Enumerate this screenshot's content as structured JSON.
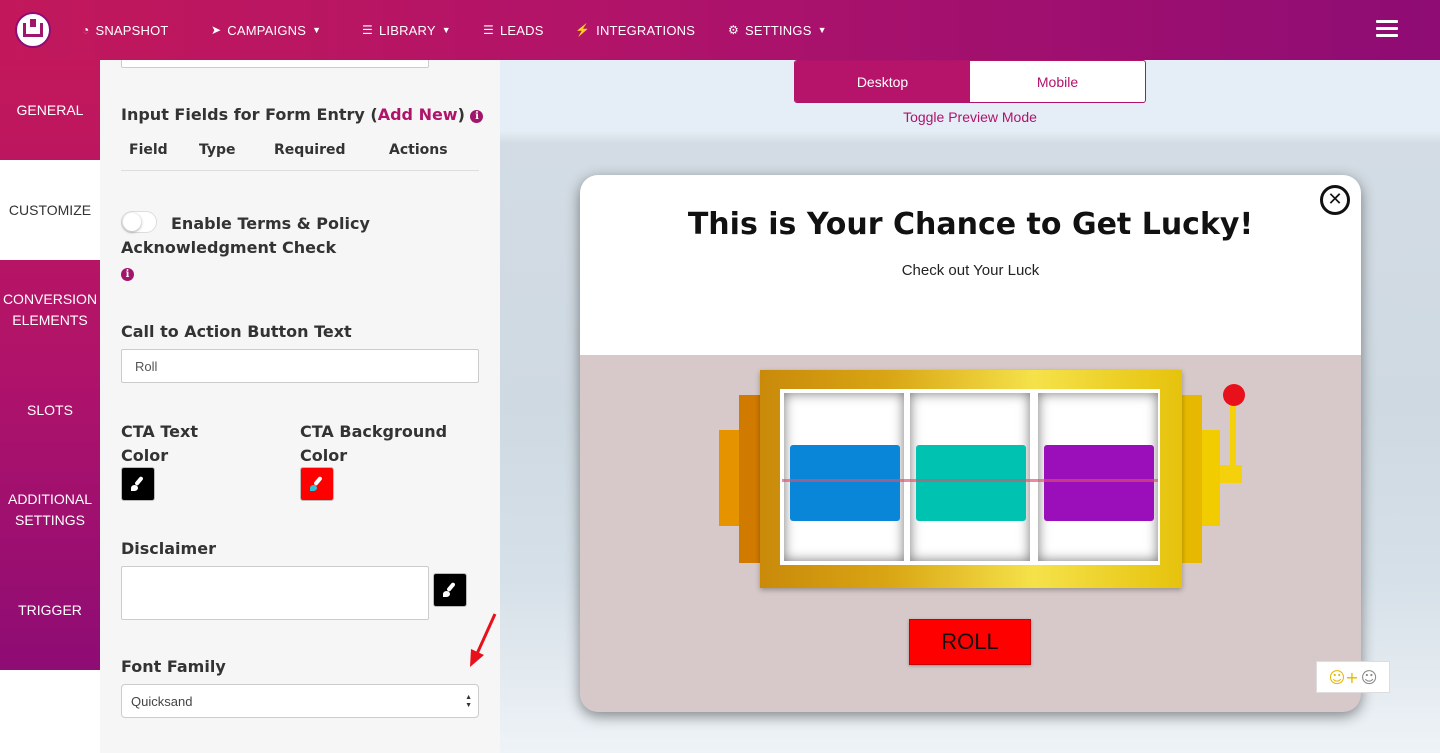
{
  "nav": {
    "items": [
      {
        "label": "SNAPSHOT",
        "icon": "dashboard-icon"
      },
      {
        "label": "CAMPAIGNS",
        "icon": "paper-plane-icon",
        "dropdown": true
      },
      {
        "label": "LIBRARY",
        "icon": "list-icon",
        "dropdown": true
      },
      {
        "label": "LEADS",
        "icon": "list-icon"
      },
      {
        "label": "INTEGRATIONS",
        "icon": "plug-icon"
      },
      {
        "label": "SETTINGS",
        "icon": "gears-icon",
        "dropdown": true
      }
    ]
  },
  "sidebar": {
    "tabs": [
      {
        "label": "GENERAL"
      },
      {
        "label": "CUSTOMIZE",
        "active": true
      },
      {
        "label": "CONVERSION ELEMENTS"
      },
      {
        "label": "SLOTS"
      },
      {
        "label": "ADDITIONAL SETTINGS"
      },
      {
        "label": "TRIGGER"
      }
    ]
  },
  "panel": {
    "input_fields_title": "Input Fields for Form Entry (",
    "add_new": "Add New",
    "input_fields_close": ")",
    "columns": [
      "Field",
      "Type",
      "Required",
      "Actions"
    ],
    "terms_label": "Enable Terms & Policy Acknowledgment Check",
    "cta_text_label": "Call to Action Button Text",
    "cta_text_value": "Roll",
    "cta_text_color_label": "CTA Text Color",
    "cta_bg_color_label": "CTA Background Color",
    "cta_text_color": "#000000",
    "cta_bg_color": "#ff0000",
    "disclaimer_label": "Disclaimer",
    "disclaimer_value": "",
    "font_family_label": "Font Family",
    "font_family_value": "Quicksand"
  },
  "preview": {
    "mode_desktop": "Desktop",
    "mode_mobile": "Mobile",
    "toggle_caption": "Toggle Preview Mode",
    "popup_title": "This is Your Chance to Get Lucky!",
    "popup_subtitle": "Check out Your Luck",
    "close_symbol": "✕",
    "roll_label": "ROLL",
    "reel_colors": [
      "#0a86d8",
      "#00c2b0",
      "#9b0fba"
    ]
  },
  "colors": {
    "brand": "#b0136a",
    "frame_gold": "#d9a514",
    "popup_bg": "#d7c9c9"
  }
}
